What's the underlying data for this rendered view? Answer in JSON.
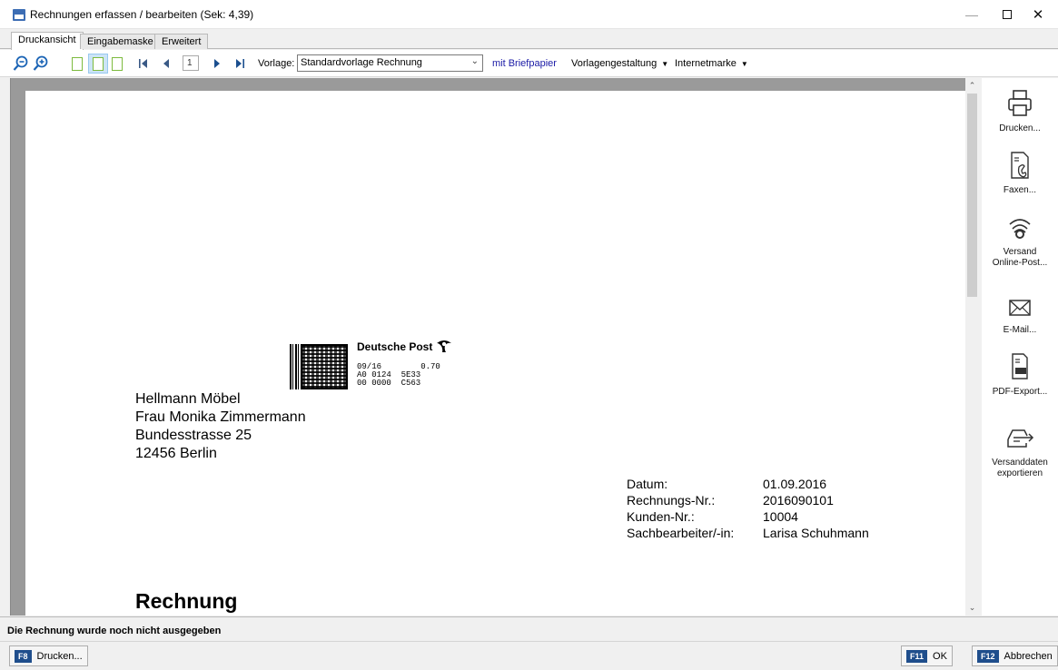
{
  "window": {
    "title": "Rechnungen erfassen / bearbeiten (Sek: 4,39)",
    "minimize": "—",
    "close": "✕"
  },
  "tabs": [
    {
      "label": "Druckansicht",
      "active": true
    },
    {
      "label": "Eingabemaske",
      "active": false
    },
    {
      "label": "Erweitert",
      "active": false
    }
  ],
  "toolbar": {
    "zoom_out_icon": "zoom-out",
    "zoom_in_icon": "zoom-in",
    "page_number": "1",
    "vorlage_label": "Vorlage:",
    "vorlage_value": "Standardvorlage Rechnung",
    "briefpapier_link": "mit Briefpapier",
    "vorlagengestaltung_menu": "Vorlagengestaltung",
    "internetmarke_menu": "Internetmarke"
  },
  "stamp": {
    "brand": "Deutsche Post",
    "line1": "09/16        0.70",
    "line2": "A0 0124  5E33",
    "line3": "00 0000  C563"
  },
  "address": {
    "company": "Hellmann Möbel",
    "contact": "Frau Monika Zimmermann",
    "street": "Bundesstrasse 25",
    "city": "12456 Berlin"
  },
  "meta": [
    {
      "label": "Datum:",
      "value": "01.09.2016"
    },
    {
      "label": "Rechnungs-Nr.:",
      "value": "2016090101"
    },
    {
      "label": "Kunden-Nr.:",
      "value": "10004"
    },
    {
      "label": "Sachbearbeiter/-in:",
      "value": "Larisa Schuhmann"
    }
  ],
  "document_title": "Rechnung",
  "actions": {
    "print": "Drucken...",
    "fax": "Faxen...",
    "online_post_line1": "Versand",
    "online_post_line2": "Online-Post...",
    "email": "E-Mail...",
    "pdf": "PDF-Export...",
    "pdf_badge": "PDF",
    "export_line1": "Versanddaten",
    "export_line2": "exportieren"
  },
  "status_text": "Die Rechnung wurde noch nicht ausgegeben",
  "bottom": {
    "print_key": "F8",
    "print_label": "Drucken...",
    "ok_key": "F11",
    "ok_label": "OK",
    "cancel_key": "F12",
    "cancel_label": "Abbrechen"
  },
  "colors": {
    "accent_blue": "#1b64b5",
    "link_blue": "#1a1aa6",
    "fkey_blue": "#1f4e8c",
    "page_icon_green": "#7dbb3e"
  }
}
